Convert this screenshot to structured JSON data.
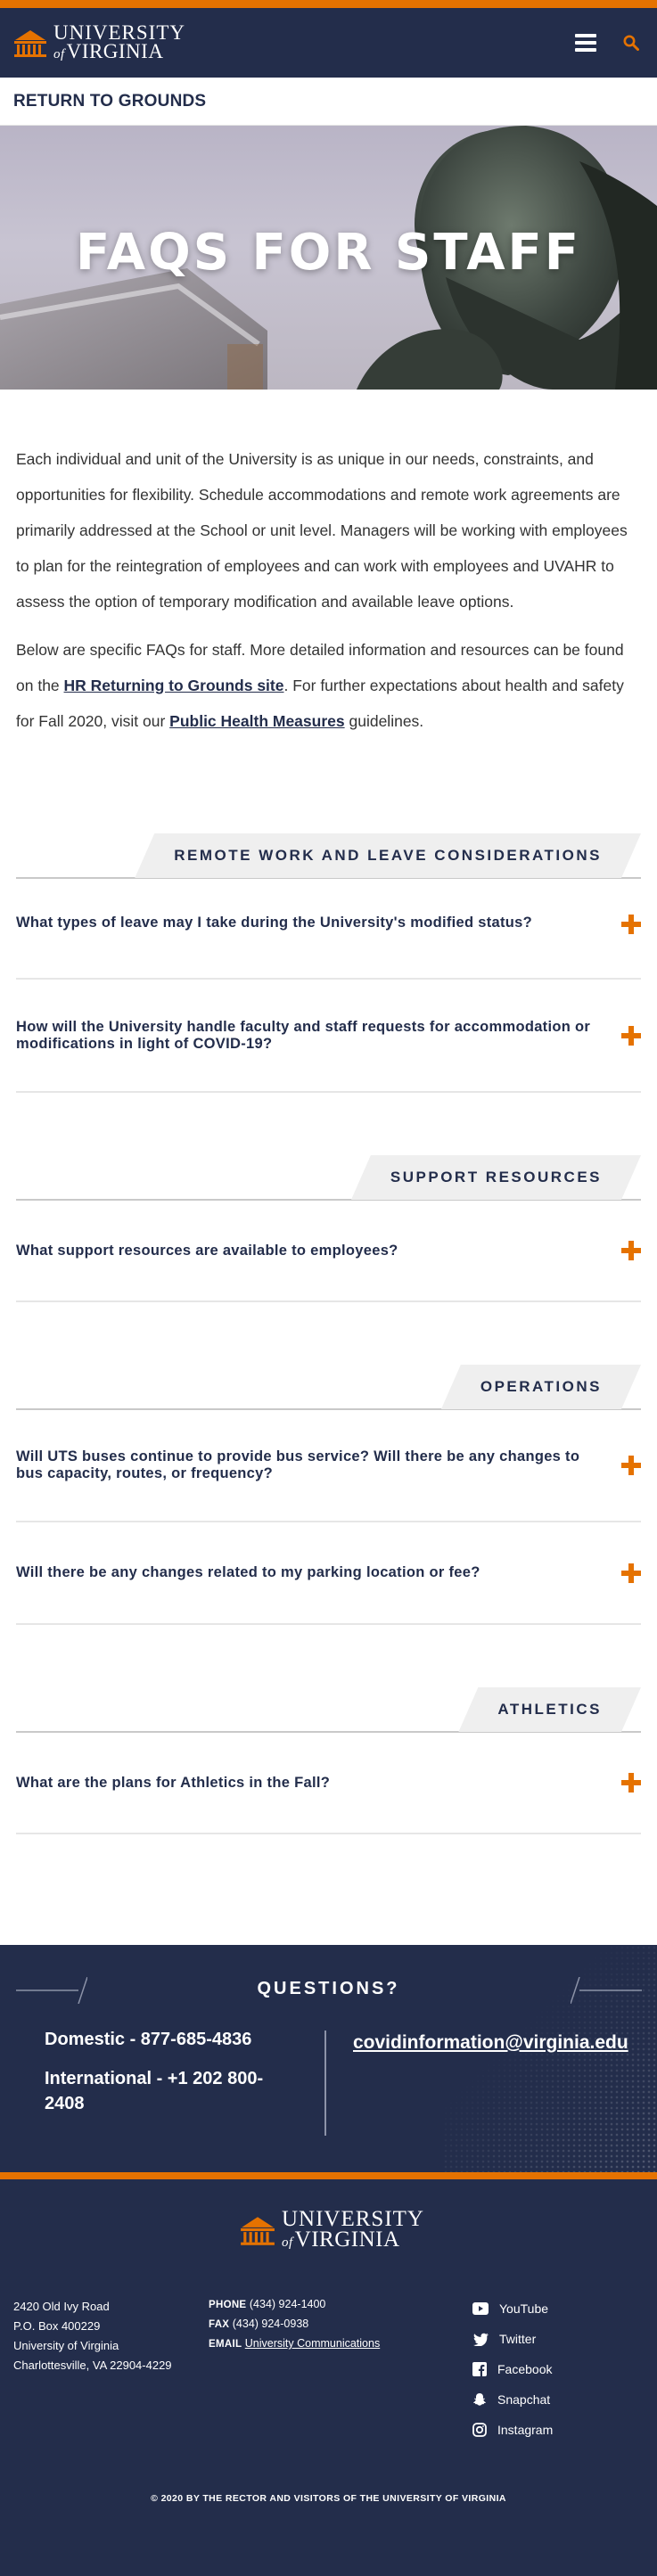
{
  "header": {
    "logo_line1": "UNIVERSITY",
    "logo_of": "of",
    "logo_line2": "VIRGINIA",
    "menu_icon": "hamburger-icon",
    "search_icon": "search-icon"
  },
  "subnav": {
    "label": "RETURN TO GROUNDS"
  },
  "hero": {
    "title": "FAQS FOR STAFF"
  },
  "intro": {
    "p1": "Each individual and unit of the University is as unique in our needs, constraints, and opportunities for flexibility. Schedule accommodations and remote work agreements are primarily addressed at the School or unit level. Managers will be working with employees to plan for the reintegration of employees and can work with employees and UVAHR to assess the option of temporary modification and available leave options.",
    "p2_a": "Below are specific FAQs for staff. More detailed information and resources can be found on the ",
    "p2_link1": "HR Returning to Grounds site",
    "p2_b": ". For further expectations about health and safety for Fall 2020, visit our ",
    "p2_link2": "Public Health Measures",
    "p2_c": " guidelines."
  },
  "sections": [
    {
      "title": "REMOTE WORK AND LEAVE CONSIDERATIONS",
      "faqs": [
        "What types of leave may I take during the University's modified status?",
        "How will the University handle faculty and staff requests for accommodation or modifications in light of COVID-19?"
      ]
    },
    {
      "title": "SUPPORT RESOURCES",
      "faqs": [
        "What support resources are available to employees?"
      ]
    },
    {
      "title": "OPERATIONS",
      "faqs": [
        "Will UTS buses continue to provide bus service? Will there be any changes to bus capacity, routes, or frequency?",
        "Will there be any changes related to my parking location or fee?"
      ]
    },
    {
      "title": "ATHLETICS",
      "faqs": [
        "What are the plans for Athletics in the Fall?"
      ]
    }
  ],
  "questions": {
    "title": "QUESTIONS?",
    "domestic": "Domestic - 877-685-4836",
    "international": "International - +1 202 800-2408",
    "email": "covidinformation@virginia.edu"
  },
  "footer": {
    "address": [
      "2420 Old Ivy Road",
      "P.O. Box 400229",
      "University of Virginia",
      "Charlottesville, VA 22904-4229"
    ],
    "phone_label": "PHONE",
    "phone": "(434) 924-1400",
    "fax_label": "FAX",
    "fax": "(434) 924-0938",
    "email_label": "EMAIL",
    "email_link": "University Communications",
    "social": [
      "YouTube",
      "Twitter",
      "Facebook",
      "Snapchat",
      "Instagram"
    ],
    "copyright": "© 2020 BY THE RECTOR AND VISITORS OF THE UNIVERSITY OF VIRGINIA"
  },
  "colors": {
    "navy": "#232d4b",
    "orange": "#e57200"
  }
}
